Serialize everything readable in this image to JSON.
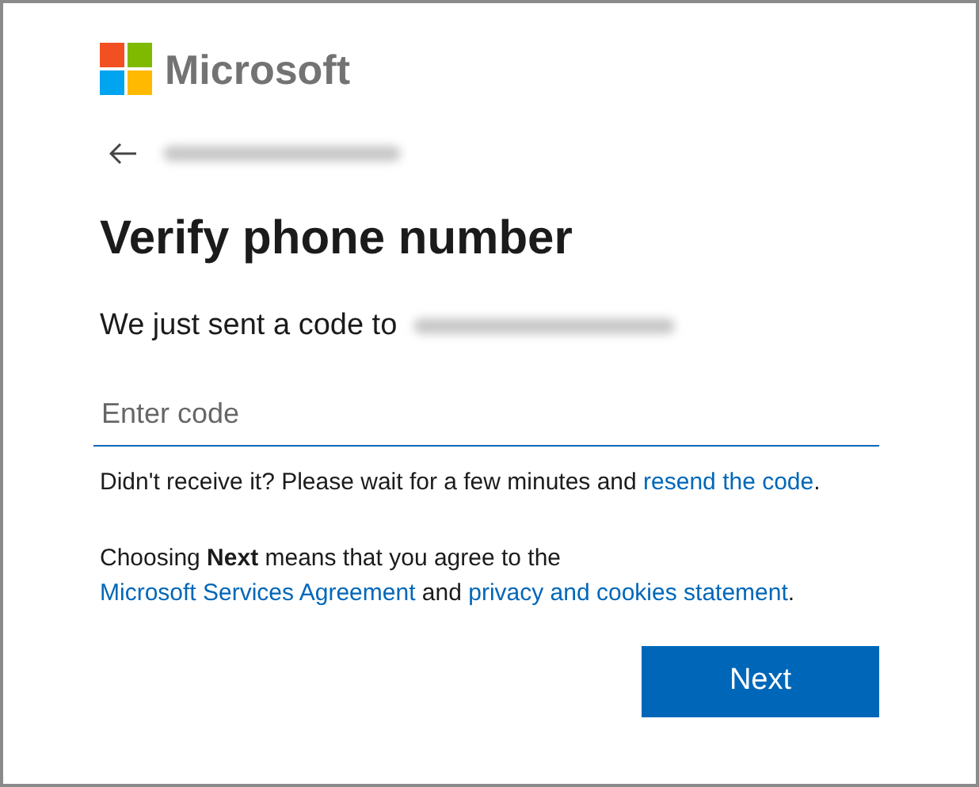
{
  "brand": {
    "name": "Microsoft"
  },
  "heading": "Verify phone number",
  "subtitle": "We just sent a code to",
  "code_field": {
    "placeholder": "Enter code"
  },
  "resend_note": [
    {
      "kind": "text",
      "text": "Didn't receive it? Please wait for a few minutes and "
    },
    {
      "kind": "link",
      "text": "resend the code"
    },
    {
      "kind": "text",
      "text": "."
    }
  ],
  "agreement": [
    {
      "kind": "text",
      "text": "Choosing **Next** means that you agree to the "
    },
    {
      "kind": "link",
      "text": "Microsoft Services Agreement"
    },
    {
      "kind": "text",
      "text": " and "
    },
    {
      "kind": "link",
      "text": "privacy and cookies statement"
    },
    {
      "kind": "text",
      "text": "."
    }
  ],
  "buttons": [
    "Next"
  ]
}
